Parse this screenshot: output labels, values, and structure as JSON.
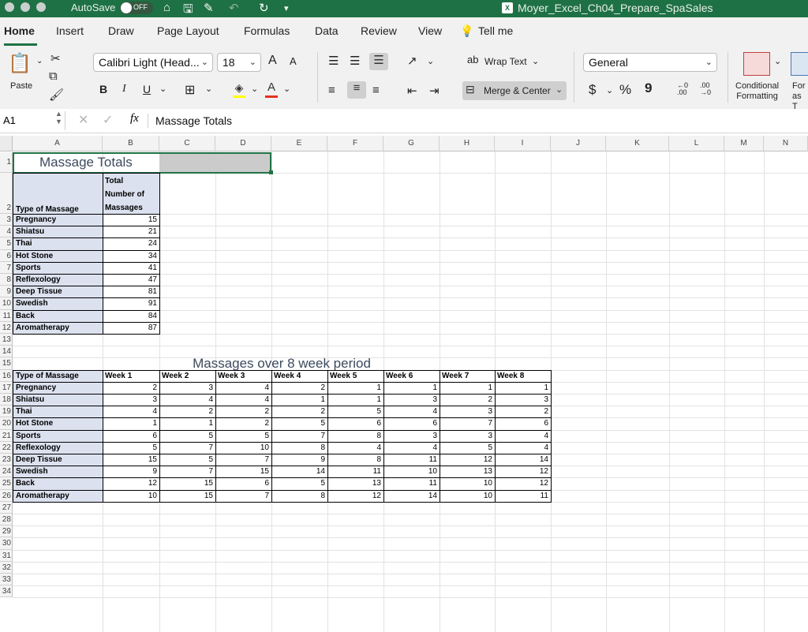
{
  "titlebar": {
    "autosave_label": "AutoSave",
    "autosave_state": "OFF",
    "document_title": "Moyer_Excel_Ch04_Prepare_SpaSales",
    "file_badge": "X"
  },
  "tabs": [
    "Home",
    "Insert",
    "Draw",
    "Page Layout",
    "Formulas",
    "Data",
    "Review",
    "View",
    "Tell me"
  ],
  "ribbon": {
    "paste_label": "Paste",
    "font_name": "Calibri Light (Head...",
    "font_size": "18",
    "grow_font": "A",
    "shrink_font": "A",
    "bold": "B",
    "italic": "I",
    "underline": "U",
    "wrap_text_icon": "ab",
    "wrap_text_label": "Wrap Text",
    "merge_center_label": "Merge & Center",
    "number_format": "General",
    "currency": "$",
    "percent": "%",
    "comma": "9",
    "increase_decimal": ".00",
    "decrease_decimal": ".00",
    "conditional_formatting_line1": "Conditional",
    "conditional_formatting_line2": "Formatting",
    "format_table_line1": "For",
    "format_table_line2": "as T"
  },
  "formula_bar": {
    "name_box": "A1",
    "fx_label": "fx",
    "formula": "Massage Totals"
  },
  "columns": [
    "A",
    "B",
    "C",
    "D",
    "E",
    "F",
    "G",
    "H",
    "I",
    "J",
    "K",
    "L",
    "M",
    "N"
  ],
  "rows": [
    "1",
    "2",
    "3",
    "4",
    "5",
    "6",
    "7",
    "8",
    "9",
    "10",
    "11",
    "12",
    "13",
    "14",
    "15",
    "16",
    "17",
    "18",
    "19",
    "20",
    "21",
    "22",
    "23",
    "24",
    "25",
    "26",
    "27",
    "28",
    "29",
    "30",
    "31",
    "32",
    "33",
    "34"
  ],
  "sheet": {
    "title1": "Massage Totals",
    "totals_table": {
      "type_header": "Type of Massage",
      "total_header": [
        "Total",
        "Number of",
        "Massages"
      ],
      "rows": [
        {
          "type": "Pregnancy",
          "total": "15"
        },
        {
          "type": "Shiatsu",
          "total": "21"
        },
        {
          "type": "Thai",
          "total": "24"
        },
        {
          "type": "Hot Stone",
          "total": "34"
        },
        {
          "type": "Sports",
          "total": "41"
        },
        {
          "type": "Reflexology",
          "total": "47"
        },
        {
          "type": "Deep Tissue",
          "total": "81"
        },
        {
          "type": "Swedish",
          "total": "91"
        },
        {
          "type": "Back",
          "total": "84"
        },
        {
          "type": "Aromatherapy",
          "total": "87"
        }
      ]
    },
    "title2": "Massages over 8 week period",
    "weekly_table": {
      "type_header": "Type of Massage",
      "week_headers": [
        "Week 1",
        "Week 2",
        "Week 3",
        "Week 4",
        "Week 5",
        "Week 6",
        "Week 7",
        "Week 8"
      ],
      "rows": [
        {
          "type": "Pregnancy",
          "values": [
            "2",
            "3",
            "4",
            "2",
            "1",
            "1",
            "1",
            "1"
          ]
        },
        {
          "type": "Shiatsu",
          "values": [
            "3",
            "4",
            "4",
            "1",
            "1",
            "3",
            "2",
            "3"
          ]
        },
        {
          "type": "Thai",
          "values": [
            "4",
            "2",
            "2",
            "2",
            "5",
            "4",
            "3",
            "2"
          ]
        },
        {
          "type": "Hot Stone",
          "values": [
            "1",
            "1",
            "2",
            "5",
            "6",
            "6",
            "7",
            "6"
          ]
        },
        {
          "type": "Sports",
          "values": [
            "6",
            "5",
            "5",
            "7",
            "8",
            "3",
            "3",
            "4"
          ]
        },
        {
          "type": "Reflexology",
          "values": [
            "5",
            "7",
            "10",
            "8",
            "4",
            "4",
            "5",
            "4"
          ]
        },
        {
          "type": "Deep Tissue",
          "values": [
            "15",
            "5",
            "7",
            "9",
            "8",
            "11",
            "12",
            "14"
          ]
        },
        {
          "type": "Swedish",
          "values": [
            "9",
            "7",
            "15",
            "14",
            "11",
            "10",
            "13",
            "12"
          ]
        },
        {
          "type": "Back",
          "values": [
            "12",
            "15",
            "6",
            "5",
            "13",
            "11",
            "10",
            "12"
          ]
        },
        {
          "type": "Aromatherapy",
          "values": [
            "10",
            "15",
            "7",
            "8",
            "12",
            "14",
            "10",
            "11"
          ]
        }
      ]
    }
  }
}
